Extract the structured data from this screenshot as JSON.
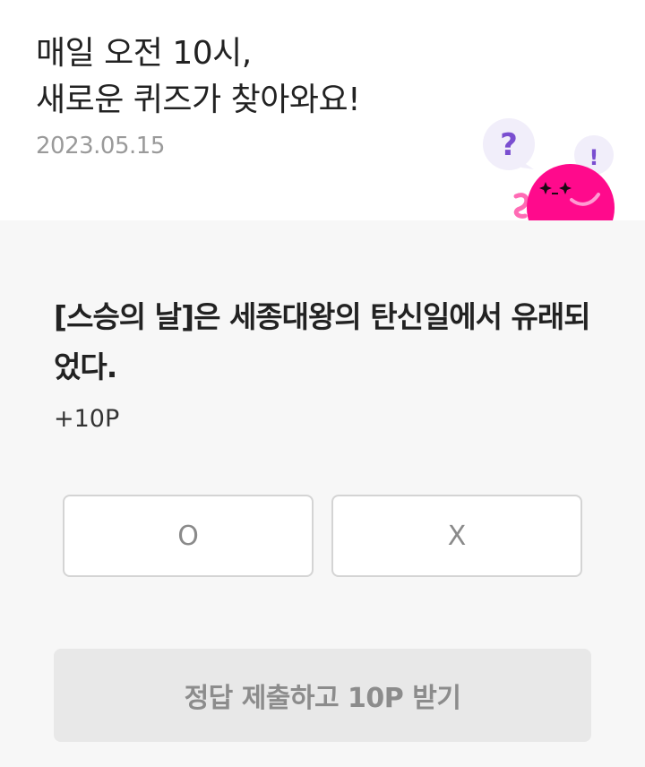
{
  "header": {
    "headline_line1": "매일 오전 10시,",
    "headline_line2": "새로운 퀴즈가 찾아와요!",
    "date": "2023.05.15"
  },
  "mascot": {
    "question_mark": "?",
    "exclamation_mark": "!",
    "body_color": "#ff0a8c",
    "bubble_color": "#f1eefa",
    "mark_color": "#7a4ed0"
  },
  "quiz": {
    "question": "[스승의 날]은 세종대왕의 탄신일에서 유래되었다.",
    "points": "+10P",
    "options": [
      {
        "label": "O"
      },
      {
        "label": "X"
      }
    ],
    "submit_label": "정답 제출하고 10P 받기"
  }
}
